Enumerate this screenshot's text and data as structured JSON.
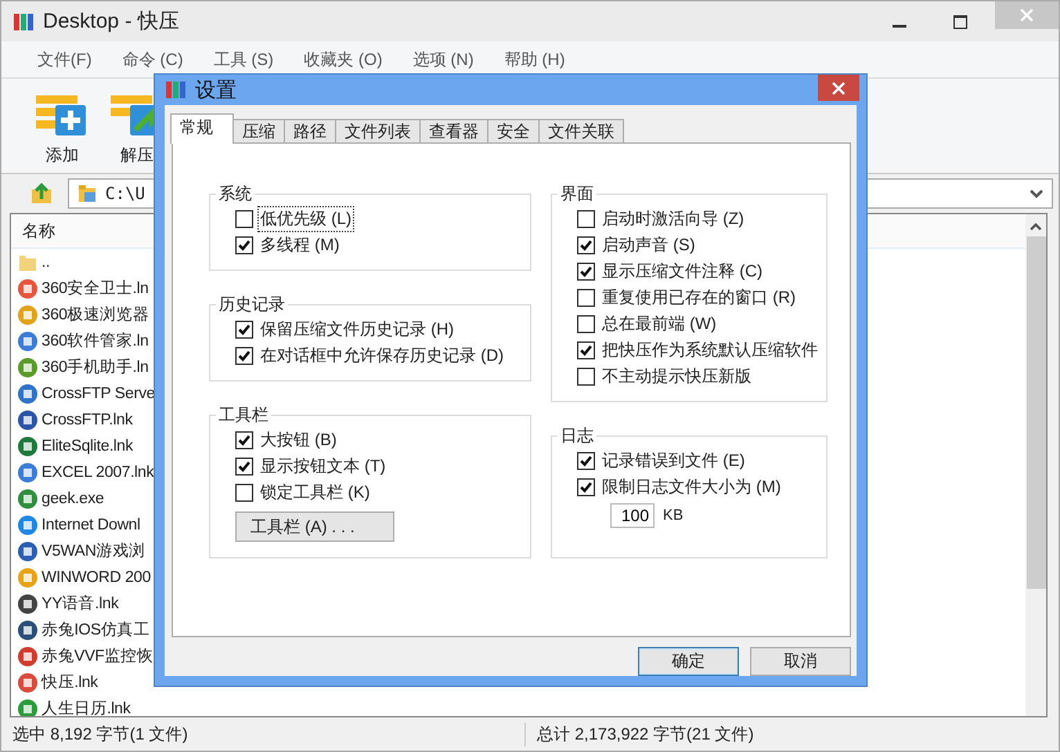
{
  "window": {
    "title": "Desktop - 快压"
  },
  "menu": [
    "文件(F)",
    "命令 (C)",
    "工具 (S)",
    "收藏夹 (O)",
    "选项 (N)",
    "帮助 (H)"
  ],
  "toolbar": [
    {
      "label": "添加",
      "kind": "add"
    },
    {
      "label": "解压",
      "kind": "extract"
    }
  ],
  "address": {
    "value": "C:\\U"
  },
  "file_list": {
    "columns": [
      "名称"
    ],
    "rows": [
      {
        "name": "..",
        "kind": "folder"
      },
      {
        "name": "360安全卫士.ln",
        "kind": "file"
      },
      {
        "name": "360极速浏览器",
        "kind": "file"
      },
      {
        "name": "360软件管家.ln",
        "kind": "file"
      },
      {
        "name": "360手机助手.ln",
        "kind": "file"
      },
      {
        "name": "CrossFTP Serve",
        "kind": "file"
      },
      {
        "name": "CrossFTP.lnk",
        "kind": "file"
      },
      {
        "name": "EliteSqlite.lnk",
        "kind": "file"
      },
      {
        "name": "EXCEL 2007.lnk",
        "kind": "file"
      },
      {
        "name": "geek.exe",
        "kind": "file"
      },
      {
        "name": "Internet Downl",
        "kind": "file"
      },
      {
        "name": "V5WAN游戏浏",
        "kind": "file"
      },
      {
        "name": "WINWORD 200",
        "kind": "file"
      },
      {
        "name": "YY语音.lnk",
        "kind": "file"
      },
      {
        "name": "赤兔IOS仿真工",
        "kind": "file"
      },
      {
        "name": "赤兔VVF监控恢",
        "kind": "file"
      },
      {
        "name": "快压.lnk",
        "kind": "file"
      },
      {
        "name": "人生日历.lnk",
        "kind": "file"
      }
    ]
  },
  "status_bar": {
    "selected": "选中 8,192 字节(1 文件)",
    "total": "总计 2,173,922 字节(21 文件)"
  },
  "dialog": {
    "title": "设置",
    "tabs": [
      {
        "label": "常规",
        "selected": true
      },
      {
        "label": "压缩",
        "selected": false
      },
      {
        "label": "路径",
        "selected": false
      },
      {
        "label": "文件列表",
        "selected": false
      },
      {
        "label": "查看器",
        "selected": false
      },
      {
        "label": "安全",
        "selected": false
      },
      {
        "label": "文件关联",
        "selected": false
      }
    ],
    "columns": [
      {
        "groups": [
          {
            "title": "系统",
            "items": [
              {
                "kind": "checkbox",
                "label": "低优先级 (L)",
                "checked": false,
                "focused": true
              },
              {
                "kind": "checkbox",
                "label": "多线程 (M)",
                "checked": true,
                "focused": false
              }
            ]
          },
          {
            "title": "历史记录",
            "items": [
              {
                "kind": "checkbox",
                "label": "保留压缩文件历史记录 (H)",
                "checked": true,
                "focused": false
              },
              {
                "kind": "checkbox",
                "label": "在对话框中允许保存历史记录 (D)",
                "checked": true,
                "focused": false
              }
            ]
          },
          {
            "title": "工具栏",
            "items": [
              {
                "kind": "checkbox",
                "label": "大按钮 (B)",
                "checked": true,
                "focused": false
              },
              {
                "kind": "checkbox",
                "label": "显示按钮文本 (T)",
                "checked": true,
                "focused": false
              },
              {
                "kind": "checkbox",
                "label": "锁定工具栏 (K)",
                "checked": false,
                "focused": false
              },
              {
                "kind": "button",
                "label": "工具栏 (A) . . ."
              }
            ]
          }
        ]
      },
      {
        "groups": [
          {
            "title": "界面",
            "items": [
              {
                "kind": "checkbox",
                "label": "启动时激活向导 (Z)",
                "checked": false,
                "focused": false
              },
              {
                "kind": "checkbox",
                "label": "启动声音 (S)",
                "checked": true,
                "focused": false
              },
              {
                "kind": "checkbox",
                "label": "显示压缩文件注释 (C)",
                "checked": true,
                "focused": false
              },
              {
                "kind": "checkbox",
                "label": "重复使用已存在的窗口 (R)",
                "checked": false,
                "focused": false
              },
              {
                "kind": "checkbox",
                "label": "总在最前端 (W)",
                "checked": false,
                "focused": false
              },
              {
                "kind": "checkbox",
                "label": "把快压作为系统默认压缩软件",
                "checked": true,
                "focused": false
              },
              {
                "kind": "checkbox",
                "label": "不主动提示快压新版",
                "checked": false,
                "focused": false
              }
            ]
          },
          {
            "title": "日志",
            "items": [
              {
                "kind": "checkbox",
                "label": "记录错误到文件 (E)",
                "checked": true,
                "focused": false
              },
              {
                "kind": "checkbox",
                "label": "限制日志文件大小为 (M)",
                "checked": true,
                "focused": false
              },
              {
                "kind": "size_field",
                "value": "100",
                "unit": "KB"
              }
            ]
          }
        ]
      }
    ],
    "buttons": [
      {
        "label": "确定",
        "default": true
      },
      {
        "label": "取消",
        "default": false
      }
    ]
  }
}
